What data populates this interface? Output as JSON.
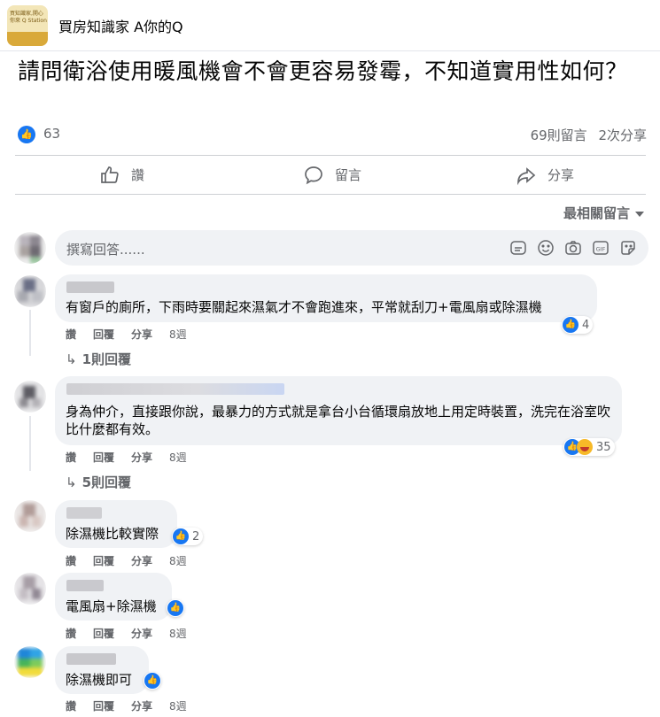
{
  "header": {
    "group_name": "買房知識家 A你的Q",
    "logo_text": "買知識家,開心你來 Q Station"
  },
  "post": {
    "title": "請問衛浴使用暖風機會不會更容易發霉，不知道實用性如何？",
    "like_count": "63",
    "comments_count": "69則留言",
    "shares_count": "2次分享"
  },
  "actions": {
    "like": "讚",
    "comment": "留言",
    "share": "分享"
  },
  "sort_label": "最相關留言",
  "composer": {
    "placeholder": "撰寫回答......",
    "icons": [
      "sticker-icon",
      "emoji-icon",
      "camera-icon",
      "gif-icon",
      "sticker-square-icon"
    ]
  },
  "comment_meta": {
    "like": "讚",
    "reply": "回覆",
    "share": "分享"
  },
  "comments": [
    {
      "text": "有窗戶的廁所，下雨時要關起來濕氣才不會跑進來，平常就刮刀+電風扇或除濕機",
      "time": "8週",
      "reactions": "4",
      "replies": "1則回覆"
    },
    {
      "text": "身為仲介，直接跟你說，最暴力的方式就是拿台小台循環扇放地上用定時裝置，洗完在浴室吹比什麼都有效。",
      "time": "8週",
      "reactions": "35",
      "replies": "5則回覆"
    },
    {
      "text": "除濕機比較實際",
      "time": "8週",
      "reactions": "2"
    },
    {
      "text": "電風扇+除濕機",
      "time": "8週",
      "reactions": ""
    },
    {
      "text": "除濕機即可",
      "time": "8週",
      "reactions": ""
    }
  ],
  "colors": {
    "brand_blue": "#1877f2",
    "muted_text": "#65676b",
    "bubble_bg": "#f0f2f5",
    "divider": "#ced0d4"
  }
}
